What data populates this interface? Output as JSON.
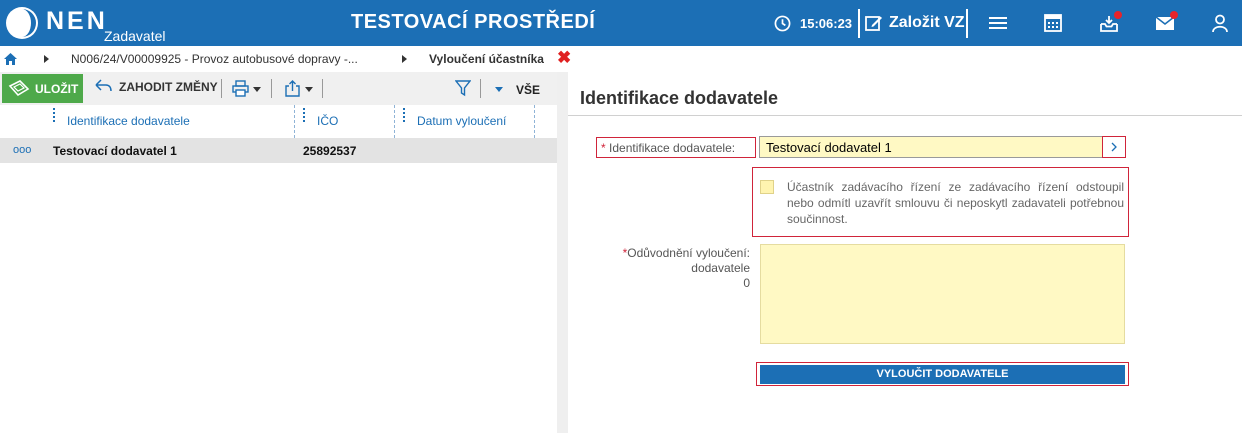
{
  "header": {
    "brand": "NEN",
    "brand_sub": "Zadavatel",
    "environment_title": "TESTOVACÍ PROSTŘEDÍ",
    "time": "15:06:23",
    "create_label": "Založit VZ",
    "icons": [
      "clock-icon",
      "edit-icon",
      "menu-icon",
      "calendar-icon",
      "inbox-download-icon",
      "mail-icon",
      "user-icon"
    ],
    "accent_color": "#1c6fb5",
    "badge_color": "#e8232a"
  },
  "breadcrumb": {
    "items": [
      "N006/24/V00009925 - Provoz autobusové dopravy -...",
      "Vyloučení účastníka"
    ],
    "close_symbol": "✖"
  },
  "toolbar": {
    "save_label": "ULOŽIT",
    "discard_label": "ZAHODIT ZMĚNY",
    "filter_all_label": "VŠE",
    "save_color": "#4ea94a"
  },
  "table": {
    "columns": [
      "Identifikace dodavatele",
      "IČO",
      "Datum vyloučení"
    ],
    "rows": [
      {
        "menu": "ooo",
        "supplier": "Testovací dodavatel 1",
        "ico": "25892537",
        "date": ""
      }
    ]
  },
  "form": {
    "section_title": "Identifikace dodavatele",
    "supplier_label": "Identifikace dodavatele:",
    "supplier_value": "Testovací dodavatel 1",
    "required_star": "*",
    "checkbox_text": "Účastník zadávacího řízení ze zadávacího řízení odstoupil nebo odmítl uzavřít smlouvu či neposkytl zadavateli potřebnou součinnost.",
    "reason_label_1": "Odůvodnění vyloučení:",
    "reason_label_2": "dodavatele",
    "reason_count": "0",
    "exclude_button": "VYLOUČIT DODAVATELE"
  }
}
